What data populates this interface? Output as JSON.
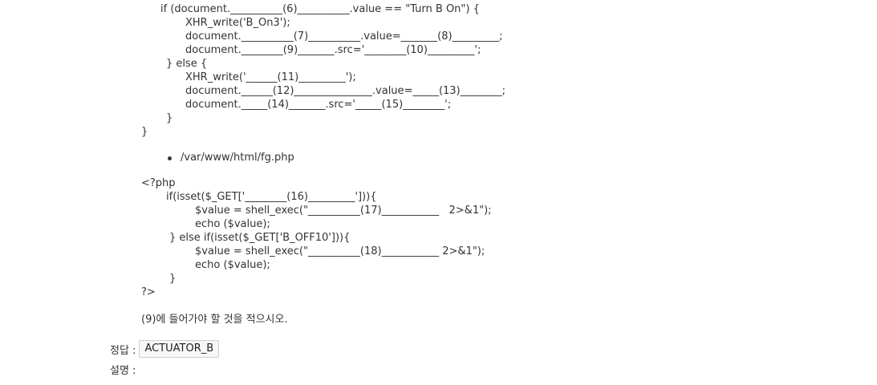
{
  "code": {
    "lines": [
      "if (document.__________(6)__________.value == \"Turn B On\") {",
      "XHR_write('B_On3');",
      "document.__________(7)__________.value=_______(8)_________;",
      "document.________(9)_______.src='________(10)_________';",
      "} else {",
      "XHR_write('______(11)_________');",
      "document.______(12)_______________.value=_____(13)________;",
      "document._____(14)_______.src='_____(15)________';",
      "}",
      "}"
    ]
  },
  "bullet": {
    "text": "/var/www/html/fg.php"
  },
  "php": {
    "lines": [
      "<?php",
      "if(isset($_GET['________(16)_________'])){",
      "$value = shell_exec(\"__________(17)___________   2>&1\");",
      "echo ($value);",
      "} else if(isset($_GET['B_OFF10'])){",
      "$value = shell_exec(\"__________(18)___________ 2>&1\");",
      "echo ($value);",
      "}",
      "?>"
    ]
  },
  "question": "(9)에 들어가야 할 것을 적으시오.",
  "answer": {
    "label": "정답 :",
    "value": "ACTUATOR_B"
  },
  "explanation": {
    "label": "설명 :"
  }
}
